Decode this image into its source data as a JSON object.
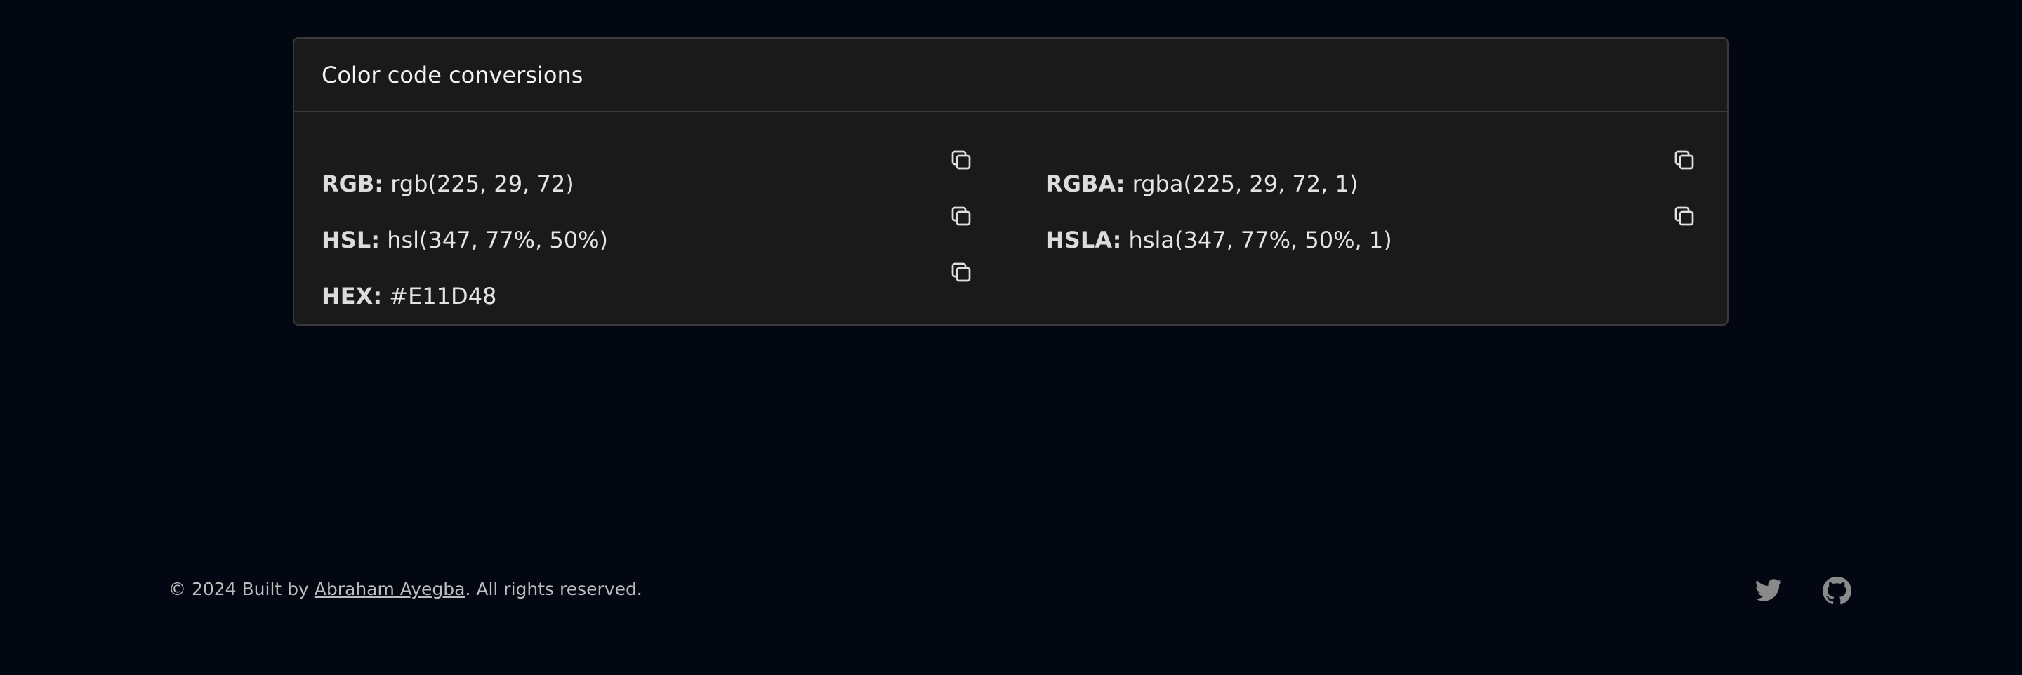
{
  "card": {
    "title": "Color code conversions"
  },
  "conversions": {
    "rgb": {
      "key": "RGB:",
      "value": "rgb(225, 29, 72)"
    },
    "rgba": {
      "key": "RGBA:",
      "value": "rgba(225, 29, 72, 1)"
    },
    "hsl": {
      "key": "HSL:",
      "value": "hsl(347, 77%, 50%)"
    },
    "hsla": {
      "key": "HSLA:",
      "value": "hsla(347, 77%, 50%, 1)"
    },
    "hex": {
      "key": "HEX:",
      "value": "#E11D48"
    }
  },
  "icons": {
    "copy": "copy-icon",
    "twitter": "twitter-icon",
    "github": "github-icon"
  },
  "footer": {
    "prefix": "© 2024 Built by ",
    "author": "Abraham Ayegba",
    "suffix": ". All rights reserved."
  },
  "colors": {
    "background": "#030712",
    "card": "#1a1a1a",
    "border": "#3a3a3a",
    "icon": "#8a8a8a"
  }
}
